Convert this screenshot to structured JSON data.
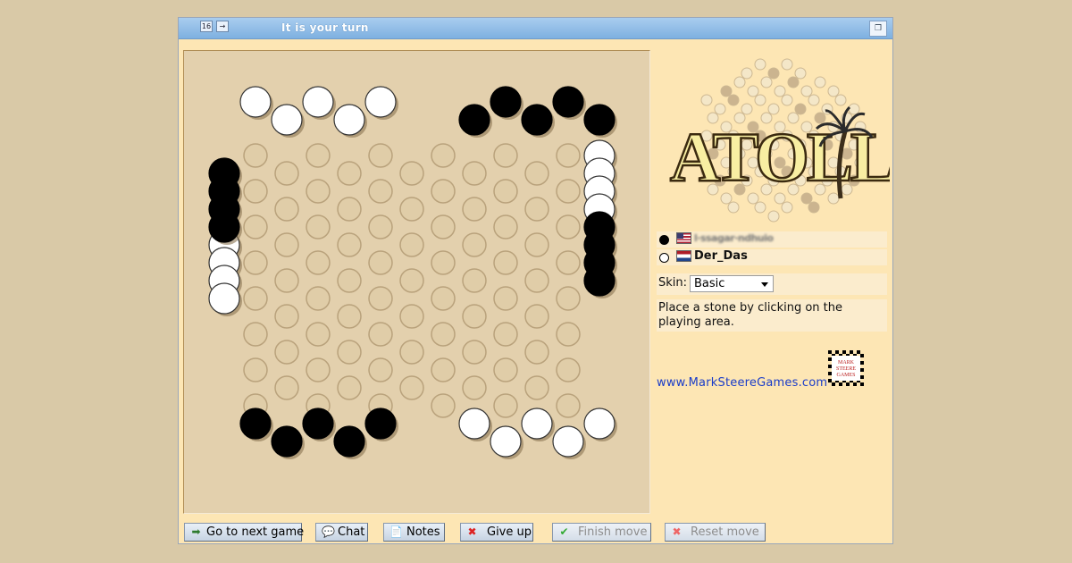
{
  "titlebar": {
    "title": "It is your turn",
    "icon_left_1": "16",
    "icon_left_2": "→",
    "icon_right": "window-restore-icon"
  },
  "board": {
    "empty_cell_color": "#e0cda8",
    "empty_cell_border": "#b9a27c",
    "white_stones": [
      [
        1,
        0
      ],
      [
        2,
        1
      ],
      [
        3,
        0
      ],
      [
        4,
        1
      ],
      [
        5,
        0
      ],
      [
        0,
        8
      ],
      [
        0,
        9
      ],
      [
        0,
        10
      ],
      [
        0,
        11
      ],
      [
        12,
        3
      ],
      [
        12,
        4
      ],
      [
        12,
        5
      ],
      [
        12,
        6
      ],
      [
        8,
        18
      ],
      [
        9,
        19
      ],
      [
        10,
        18
      ],
      [
        11,
        19
      ],
      [
        12,
        18
      ]
    ],
    "black_stones": [
      [
        8,
        1
      ],
      [
        9,
        0
      ],
      [
        10,
        1
      ],
      [
        11,
        0
      ],
      [
        12,
        1
      ],
      [
        0,
        4
      ],
      [
        0,
        5
      ],
      [
        0,
        6
      ],
      [
        0,
        7
      ],
      [
        12,
        7
      ],
      [
        12,
        8
      ],
      [
        12,
        9
      ],
      [
        12,
        10
      ],
      [
        1,
        18
      ],
      [
        2,
        19
      ],
      [
        3,
        18
      ],
      [
        4,
        19
      ],
      [
        5,
        18
      ]
    ]
  },
  "logo": {
    "text": "ATOLL"
  },
  "players": [
    {
      "stone": "black",
      "flag": "us",
      "name": "l·ssagar·ndhuio"
    },
    {
      "stone": "white",
      "flag": "nl",
      "name": "Der_Das"
    }
  ],
  "skin": {
    "label": "Skin:",
    "selected": "Basic"
  },
  "instruction": "Place a stone by clicking on the playing area.",
  "site_link": "www.MarkSteereGames.com",
  "msg_logo_text": [
    "MARK",
    "STEERE",
    "GAMES"
  ],
  "buttons": {
    "next_game": "Go to next game",
    "chat": "Chat",
    "notes": "Notes",
    "give_up": "Give up",
    "finish_move": "Finish move",
    "reset_move": "Reset move"
  }
}
